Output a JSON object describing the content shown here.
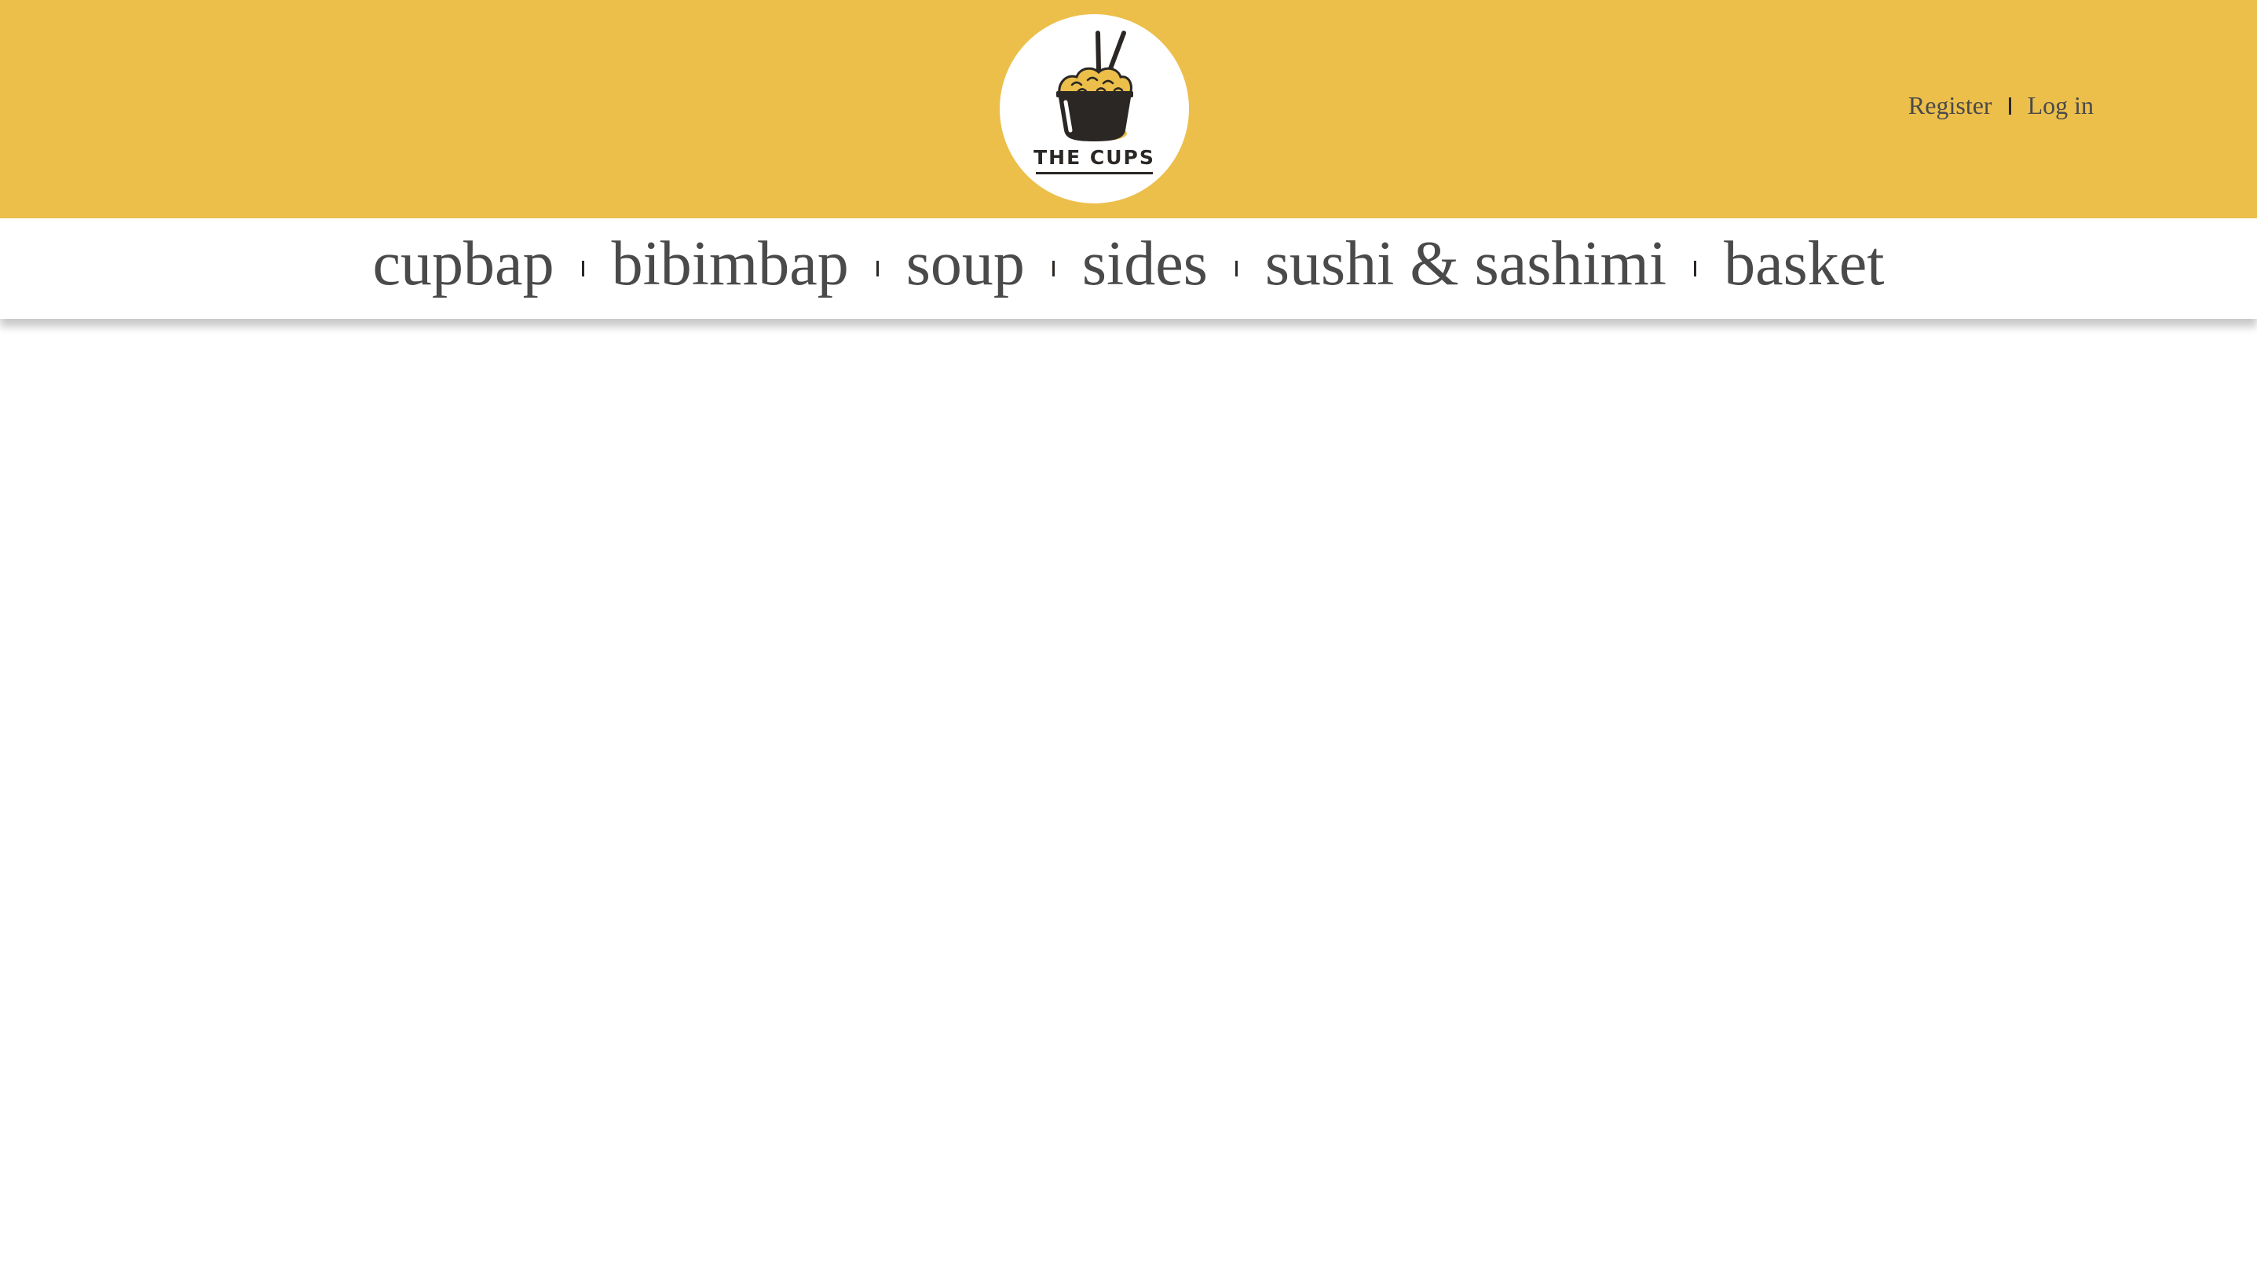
{
  "brand": {
    "name": "THE CUPS",
    "accent_color": "#ECBF4B",
    "logo_icon": "rice-cup-with-chopsticks-icon"
  },
  "account": {
    "register_label": "Register",
    "login_label": "Log in"
  },
  "nav": {
    "items": [
      {
        "label": "cupbap"
      },
      {
        "label": "bibimbap"
      },
      {
        "label": "soup"
      },
      {
        "label": "sides"
      },
      {
        "label": "sushi & sashimi"
      },
      {
        "label": "basket"
      }
    ]
  }
}
